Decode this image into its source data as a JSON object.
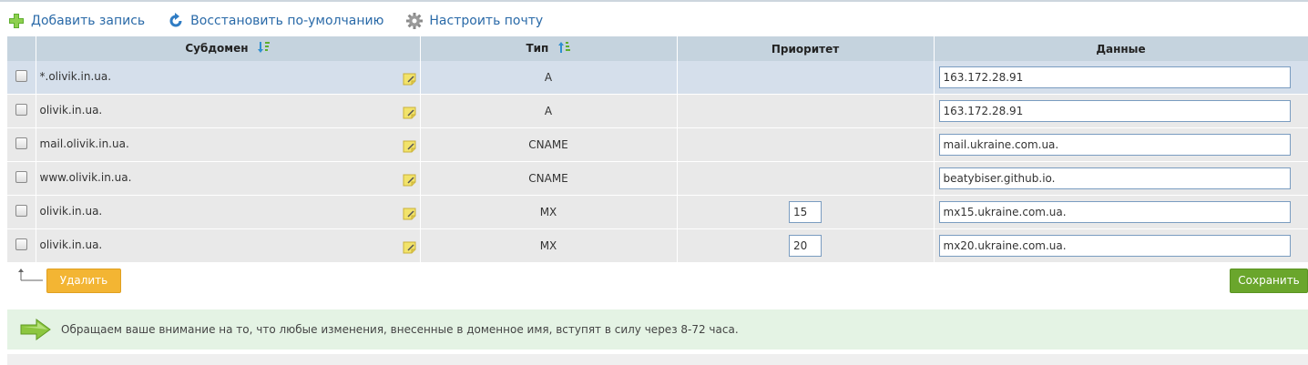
{
  "toolbar": {
    "add_label": "Добавить запись",
    "restore_label": "Восстановить по-умолчанию",
    "mail_label": "Настроить почту"
  },
  "table": {
    "headers": {
      "subdomain": "Субдомен",
      "type": "Тип",
      "priority": "Приоритет",
      "data": "Данные"
    },
    "rows": [
      {
        "subdomain": "*.olivik.in.ua.",
        "type": "A",
        "priority": "",
        "data": "163.172.28.91"
      },
      {
        "subdomain": "olivik.in.ua.",
        "type": "A",
        "priority": "",
        "data": "163.172.28.91"
      },
      {
        "subdomain": "mail.olivik.in.ua.",
        "type": "CNAME",
        "priority": "",
        "data": "mail.ukraine.com.ua."
      },
      {
        "subdomain": "www.olivik.in.ua.",
        "type": "CNAME",
        "priority": "",
        "data": "beatybiser.github.io."
      },
      {
        "subdomain": "olivik.in.ua.",
        "type": "MX",
        "priority": "15",
        "data": "mx15.ukraine.com.ua."
      },
      {
        "subdomain": "olivik.in.ua.",
        "type": "MX",
        "priority": "20",
        "data": "mx20.ukraine.com.ua."
      }
    ]
  },
  "actions": {
    "delete_label": "Удалить",
    "save_label": "Сохранить"
  },
  "notice": {
    "text": "Обращаем ваше внимание на то, что любые изменения, внесенные в доменное имя, вступят в силу через 8-72 часа."
  },
  "colors": {
    "link": "#2a6aa8",
    "header_bg": "#c5d3de",
    "delete_button": "#f3b533",
    "save_button": "#6aa62c",
    "notice_bg": "#e4f3e4"
  },
  "icons": {
    "add": "plus-icon",
    "restore": "refresh-icon",
    "mail": "gear-icon",
    "sort": "sort-icon",
    "edit": "note-edit-icon",
    "notice": "arrow-right-icon"
  }
}
